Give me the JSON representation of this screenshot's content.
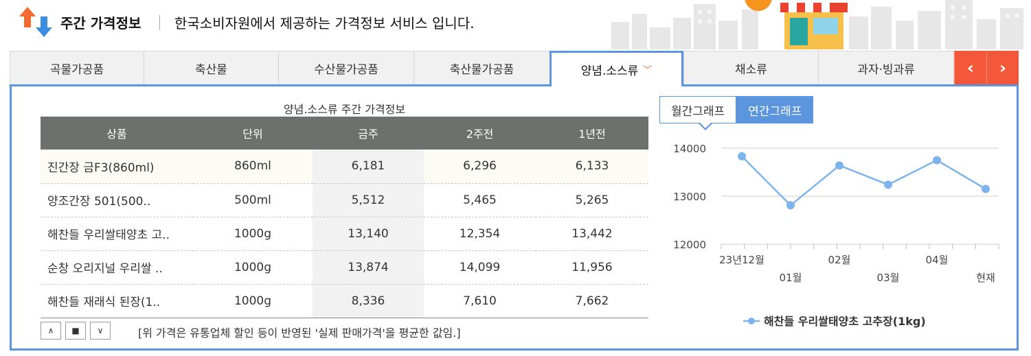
{
  "header": {
    "title": "주간 가격정보",
    "subtitle": "한국소비자원에서 제공하는 가격정보 서비스 입니다."
  },
  "tabs": [
    {
      "label": "곡물가공품"
    },
    {
      "label": "축산물"
    },
    {
      "label": "수산물가공품"
    },
    {
      "label": "축산물가공품"
    },
    {
      "label": "양념.소스류",
      "active": true
    },
    {
      "label": "채소류"
    },
    {
      "label": "과자·빙과류"
    }
  ],
  "tab_nav": {
    "prev": "‹",
    "next": "›"
  },
  "table": {
    "caption": "양념.소스류 주간 가격정보",
    "headers": [
      "상품",
      "단위",
      "금주",
      "2주전",
      "1년전"
    ],
    "rows": [
      [
        "진간장 금F3(860ml)",
        "860ml",
        "6,181",
        "6,296",
        "6,133"
      ],
      [
        "양조간장 501(500..",
        "500ml",
        "5,512",
        "5,465",
        "5,265"
      ],
      [
        "해찬들 우리쌀태양초 고..",
        "1000g",
        "13,140",
        "12,354",
        "13,442"
      ],
      [
        "순창 오리지널 우리쌀 ..",
        "1000g",
        "13,874",
        "14,099",
        "11,956"
      ],
      [
        "해찬들 재래식 된장(1..",
        "1000g",
        "8,336",
        "7,610",
        "7,662"
      ]
    ]
  },
  "controls": {
    "up": "∧",
    "stop": "■",
    "down": "∨"
  },
  "note": "[위 가격은 유통업체 할인 등이 반영된 '실제 판매가격'을 평균한 값임.]",
  "graph": {
    "tab_monthly": "월간그래프",
    "tab_yearly": "연간그래프",
    "accent": "#5b95de",
    "line_color": "#7eb4ec"
  },
  "chart_data": {
    "type": "line",
    "categories": [
      "23년12월",
      "01월",
      "02월",
      "03월",
      "04월",
      "현재"
    ],
    "series": [
      {
        "name": "해찬들 우리쌀태양초 고추장(1kg)",
        "values": [
          13830,
          12810,
          13640,
          13240,
          13750,
          13150
        ]
      }
    ],
    "yticks": [
      "14000",
      "13000",
      "12000"
    ],
    "ylim": [
      12000,
      14000
    ],
    "legend": "bottom",
    "grid": true
  }
}
